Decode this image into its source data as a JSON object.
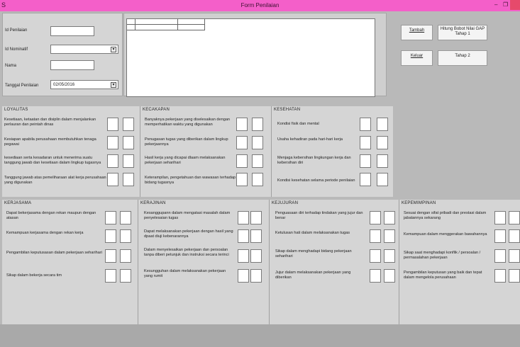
{
  "window": {
    "title": "Form Penilaian",
    "app_glyph": "S",
    "minimize_glyph": "–",
    "restore_glyph": "❐"
  },
  "header_form": {
    "id_penilaian_label": "Id Penilaian",
    "id_nominatif_label": "Id Nominatif",
    "nama_label": "Nama",
    "tanggal_label": "Tanggal Penilaian",
    "tanggal_value": "02/05/2016"
  },
  "buttons": {
    "tambah": "Tambah",
    "keluar": "Keluar",
    "hitung_tahap1": "Hitung Bobot Nilai GAP Tahap 1",
    "tahap2": "Tahap 2"
  },
  "sections": {
    "loyalitas": {
      "title": "LOYALITAS",
      "items": [
        "Kesetiaan, ketaatan dan disiplin dalam menjalankan perlauran dan peintah dinas",
        "Kesiapan apabila perusahaan membutuhkan tenaga pegawai",
        "kesediaan serta kesadaran untuk menerima suatu tanggung jawab dan kesetiaan dalam lingkup tugasnya",
        "Tanggung jawab atas pemeliharaan alat kerja perusahaan yang digunakan"
      ]
    },
    "kecakapan": {
      "title": "KECAKAPAN",
      "items": [
        "Banyaknya pekerjaan yang diselesaikan dengan memperhatikan waktu yang digunakan",
        "Penugasan tugas yang diberikan dalam lingkup pekerjaannya",
        "Hasil kerja yang dicapai dlaam melaksanakan pekerjaan seharihari",
        "Keterampilan, pengetahuan dan wawasan terhadap bidang tugasnya"
      ]
    },
    "kesehatan": {
      "title": "KESEHATAN",
      "items": [
        "Kondisi fisik dan mental",
        "Usaha kehadiran pada hari-hari kerja",
        "Menjaga kebersihan lingkungan kerja dan kebersihan diri",
        "Kondisi kesehatan selama periode penilaian"
      ]
    },
    "kerjasama": {
      "title": "KERJASAMA",
      "items": [
        "Dapat bekerjasama dengan rekan maupun dengan atasan",
        "Kemampuan kerjasama dengan rekan kerja",
        "Pengambilan keputusasan dalam pekerjaan seharihari",
        "Sikap dalam bekerja secara tim"
      ]
    },
    "kerajinan": {
      "title": "KERAJINAN",
      "items": [
        "Kesanggupann dalam mengatasi masalah dalam penyelesaian tugas",
        "Dapat melaksanakan pekerjaan dengan hasil yang dpaat diuji kebenarannya",
        "Dalam menyelesaikan pekerjaan dan persoalan tanpa diberi petunjuk dan instruksi secara terinci",
        "Kesungguhan dalam melaksanakan pekerjaan yang rumit"
      ]
    },
    "kejujuran": {
      "title": "KEJUJURAN",
      "items": [
        "Penguasaan diri terhadap tindakan yang jujur dan benar",
        "Ketulusan hati dalam melaksanakan tugas",
        "Sikap dalam menghadapi bidang pekerjaan seharihari",
        "Jujur dalam melaksanakan pekerjaan yang diberikan"
      ]
    },
    "kepemimpinan": {
      "title": "KEPEMIMPINAN",
      "items": [
        "Sesuai dengan sifat pribadi dan prestasi dalam jabatannya sekarang",
        "Kemampuan dalam menggerakan bawahannya",
        "Sikap saat menghadapi konflik / persoalan / permasalahan pekerjaan",
        "Pengambilan keputusan yang baik dan tepat dalam mengelola perusahaan"
      ]
    }
  },
  "colors": {
    "titlebar": "#f45fc9",
    "panel": "#d5d5d5",
    "background": "#b9b9b9"
  }
}
